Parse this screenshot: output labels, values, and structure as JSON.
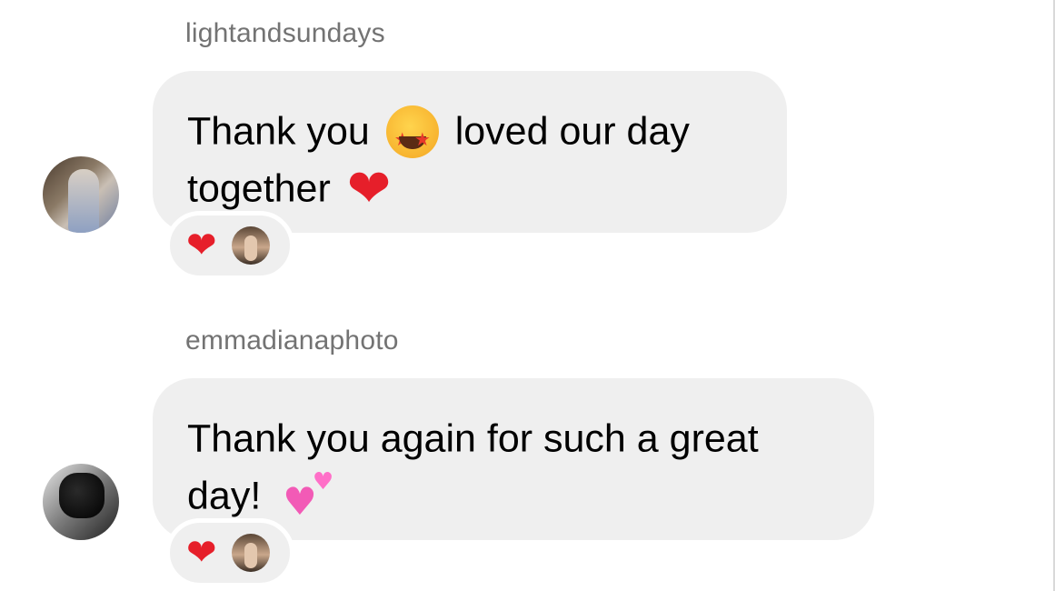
{
  "messages": [
    {
      "sender": "lightandsundays",
      "text_line1_a": "Thank you",
      "text_line1_b": "loved our day",
      "text_line2": "together",
      "reaction": "❤"
    },
    {
      "sender": "emmadianaphoto",
      "text_line1": "Thank you again for such a great",
      "text_line2": "day!",
      "reaction": "❤"
    }
  ],
  "icons": [
    "star-struck-emoji-icon",
    "red-heart-icon",
    "two-hearts-icon",
    "avatar-icon"
  ],
  "colors": {
    "bubble": "#efefef",
    "sender_text": "#737373",
    "heart_red": "#e61f2a",
    "heart_pink": "#f25ab6"
  }
}
